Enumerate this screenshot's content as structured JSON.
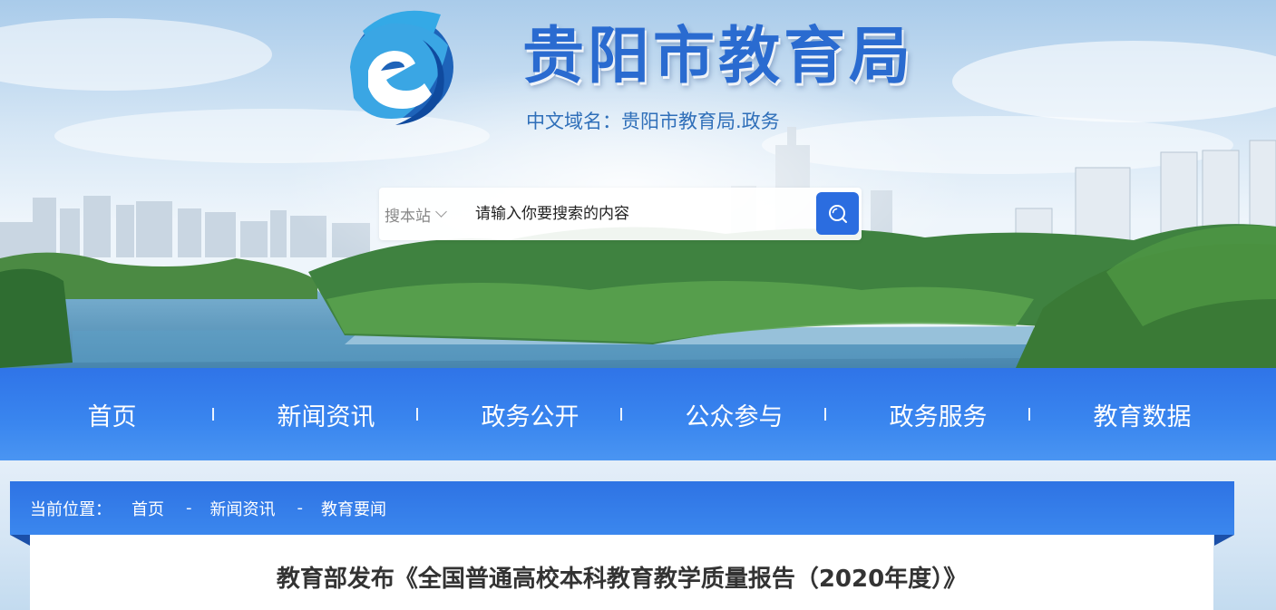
{
  "header": {
    "site_title": "贵阳市教育局",
    "domain_line": "中文域名：贵阳市教育局.政务"
  },
  "search": {
    "scope_label": "搜本站",
    "placeholder": "请输入你要搜索的内容"
  },
  "nav": {
    "items": [
      {
        "label": "首页"
      },
      {
        "label": "新闻资讯"
      },
      {
        "label": "政务公开"
      },
      {
        "label": "公众参与"
      },
      {
        "label": "政务服务"
      },
      {
        "label": "教育数据"
      }
    ]
  },
  "breadcrumb": {
    "label": "当前位置：",
    "items": [
      "首页",
      "新闻资讯",
      "教育要闻"
    ],
    "separator": "-"
  },
  "article": {
    "title": "教育部发布《全国普通高校本科教育教学质量报告（2020年度）》"
  },
  "colors": {
    "brand_blue": "#2b6de0",
    "nav_blue": "#3a86ef",
    "title_blue": "#2a6bd0"
  },
  "icons": {
    "search": "magnifier-icon",
    "logo": "e-emblem-logo"
  }
}
